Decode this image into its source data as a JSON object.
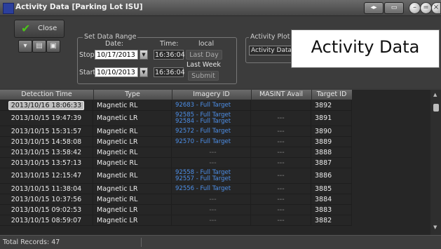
{
  "window": {
    "title": "Activity Data [Parking Lot ISU]"
  },
  "titlebar_buttons": {
    "left_glyph": "◂▸",
    "right_glyph": "▭"
  },
  "controls": {
    "close_label": "Close",
    "toolbar_icons": [
      "bucket-icon",
      "print-icon",
      "export-icon"
    ],
    "date_range": {
      "legend": "Set Data Range",
      "date_header": "Date:",
      "time_header": "Time:",
      "zone_header": "local",
      "stop_label": "Stop",
      "start_label": "Start",
      "stop_date": "10/17/2013",
      "start_date": "10/10/2013",
      "stop_time": "16:36:04",
      "start_time": "16:36:04",
      "last_day": "Last Day",
      "last_week": "Last Week",
      "submit": "Submit"
    },
    "activity_plot": {
      "legend": "Activity Plot",
      "selected": "Activity Data"
    }
  },
  "callout": {
    "text": "Activity Data"
  },
  "table": {
    "headers": [
      "Detection Time",
      "Type",
      "Imagery ID",
      "MASINT Avail",
      "Target ID"
    ],
    "rows": [
      {
        "time": "2013/10/16 18:06:33",
        "type": "Magnetic RL",
        "imagery": [
          "92683 - Full Target"
        ],
        "masint": "",
        "target": "3892"
      },
      {
        "time": "2013/10/15 19:47:39",
        "type": "Magnetic LR",
        "imagery": [
          "92585 - Full Target",
          "92584 - Full Target"
        ],
        "masint": "---",
        "target": "3891"
      },
      {
        "time": "2013/10/15 15:31:57",
        "type": "Magnetic RL",
        "imagery": [
          "92572 - Full Target"
        ],
        "masint": "---",
        "target": "3890"
      },
      {
        "time": "2013/10/15 14:58:08",
        "type": "Magnetic LR",
        "imagery": [
          "92570 - Full Target"
        ],
        "masint": "---",
        "target": "3889"
      },
      {
        "time": "2013/10/15 13:58:42",
        "type": "Magnetic RL",
        "imagery": [],
        "masint": "---",
        "target": "3888"
      },
      {
        "time": "2013/10/15 13:57:13",
        "type": "Magnetic RL",
        "imagery": [],
        "masint": "---",
        "target": "3887"
      },
      {
        "time": "2013/10/15 12:15:47",
        "type": "Magnetic RL",
        "imagery": [
          "92558 - Full Target",
          "92557 - Full Target"
        ],
        "masint": "---",
        "target": "3886"
      },
      {
        "time": "2013/10/15 11:38:04",
        "type": "Magnetic LR",
        "imagery": [
          "92556 - Full Target"
        ],
        "masint": "---",
        "target": "3885"
      },
      {
        "time": "2013/10/15 10:37:56",
        "type": "Magnetic RL",
        "imagery": [],
        "masint": "---",
        "target": "3884"
      },
      {
        "time": "2013/10/15 09:02:53",
        "type": "Magnetic LR",
        "imagery": [],
        "masint": "---",
        "target": "3883"
      },
      {
        "time": "2013/10/15 08:59:07",
        "type": "Magnetic LR",
        "imagery": [],
        "masint": "---",
        "target": "3882"
      }
    ],
    "empty_imagery": "---"
  },
  "status": {
    "total_records": "Total Records: 47"
  },
  "colors": {
    "link": "#4d8fe8",
    "check": "#4cc41a",
    "background": "#3a3a3a"
  }
}
